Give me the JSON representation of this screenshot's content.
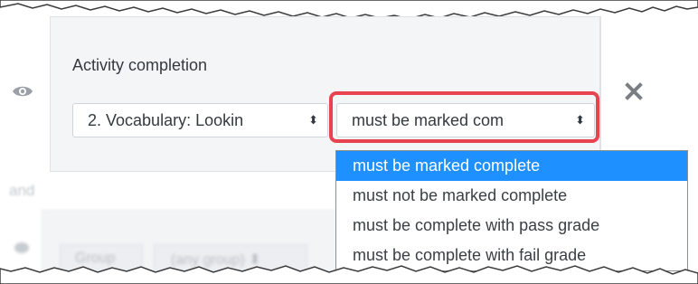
{
  "section": {
    "label": "Activity completion"
  },
  "activity_select": {
    "value": "2. Vocabulary: Lookin",
    "arrows": "⬍"
  },
  "condition_select": {
    "value": "must be marked com",
    "arrows": "⬍"
  },
  "dropdown": {
    "options": [
      "must be marked complete",
      "must not be marked complete",
      "must be complete with pass grade",
      "must be complete with fail grade"
    ],
    "selected_index": 0
  },
  "icons": {
    "visibility": "eye-icon",
    "remove": "close-icon"
  },
  "colors": {
    "highlight_border": "#e8444f",
    "selected_option": "#1e90ff",
    "panel_bg": "#f4f5f7"
  }
}
